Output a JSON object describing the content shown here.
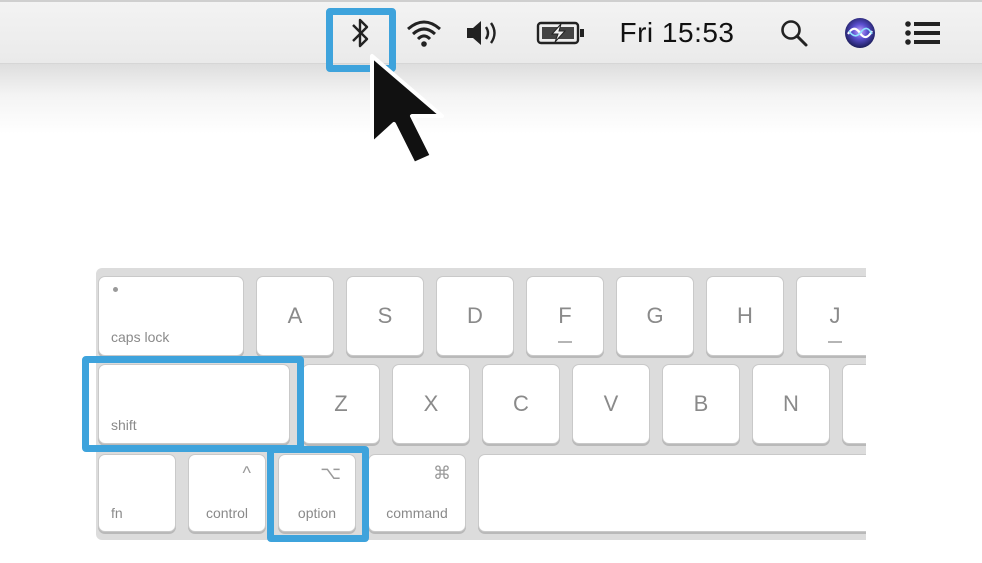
{
  "menubar": {
    "clock": "Fri 15:53",
    "icons": [
      "bluetooth-icon",
      "wifi-icon",
      "volume-icon",
      "battery-charging-icon",
      "spotlight-search-icon",
      "siri-icon",
      "notification-center-icon"
    ]
  },
  "colors": {
    "highlight": "#3ea3dc"
  },
  "keyboard": {
    "row1": {
      "caps_lock": "caps lock",
      "keys": [
        "A",
        "S",
        "D",
        "F",
        "G",
        "H",
        "J"
      ]
    },
    "row2": {
      "shift": "shift",
      "keys": [
        "Z",
        "X",
        "C",
        "V",
        "B",
        "N"
      ]
    },
    "row3": {
      "fn": "fn",
      "control": "control",
      "control_symbol": "^",
      "option": "option",
      "option_symbol": "⌥",
      "command": "command",
      "command_symbol": "⌘"
    }
  }
}
